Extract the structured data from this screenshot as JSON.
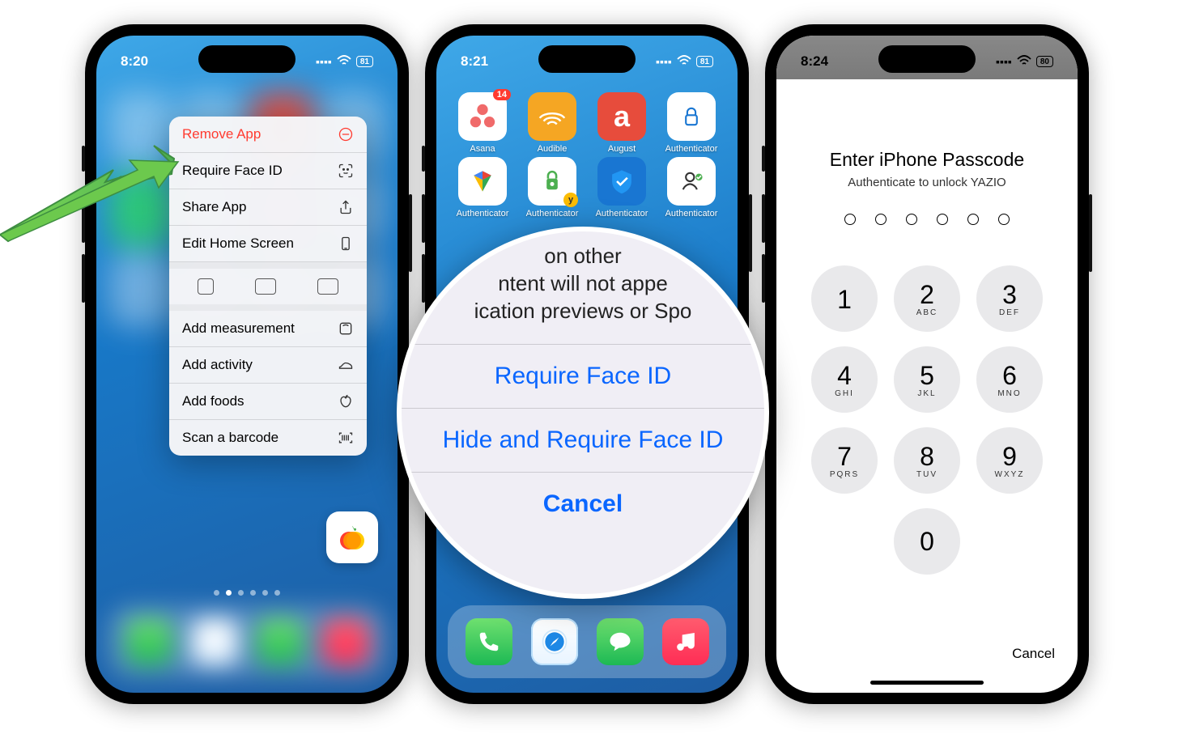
{
  "phone1": {
    "time": "8:20",
    "battery": "81",
    "menu": {
      "remove": "Remove App",
      "faceid": "Require Face ID",
      "share": "Share App",
      "edit": "Edit Home Screen",
      "measurement": "Add measurement",
      "activity": "Add activity",
      "foods": "Add foods",
      "barcode": "Scan a barcode"
    }
  },
  "phone2": {
    "time": "8:21",
    "battery": "81",
    "apps": [
      {
        "label": "Asana",
        "badge": "14",
        "bg": "#fff"
      },
      {
        "label": "Audible",
        "bg": "#f5a623"
      },
      {
        "label": "August",
        "bg": "#e74c3c"
      },
      {
        "label": "Authenticator",
        "bg": "#fff"
      },
      {
        "label": "Authenticator",
        "bg": "#fff"
      },
      {
        "label": "Authenticator",
        "bg": "#fff"
      },
      {
        "label": "Authenticator",
        "bg": "#fff"
      },
      {
        "label": "Authenticator",
        "bg": "#fff"
      }
    ],
    "zoom": {
      "hint_l1": "on other",
      "hint_l2": "ntent will not appe",
      "hint_l3": "ication previews or Spo",
      "opt1": "Require Face ID",
      "opt2": "Hide and Require Face ID",
      "cancel": "Cancel"
    }
  },
  "phone3": {
    "time": "8:24",
    "battery": "80",
    "title": "Enter iPhone Passcode",
    "subtitle": "Authenticate to unlock YAZIO",
    "cancel": "Cancel",
    "keys": [
      {
        "n": "1",
        "l": ""
      },
      {
        "n": "2",
        "l": "ABC"
      },
      {
        "n": "3",
        "l": "DEF"
      },
      {
        "n": "4",
        "l": "GHI"
      },
      {
        "n": "5",
        "l": "JKL"
      },
      {
        "n": "6",
        "l": "MNO"
      },
      {
        "n": "7",
        "l": "PQRS"
      },
      {
        "n": "8",
        "l": "TUV"
      },
      {
        "n": "9",
        "l": "WXYZ"
      },
      {
        "n": "0",
        "l": ""
      }
    ]
  }
}
